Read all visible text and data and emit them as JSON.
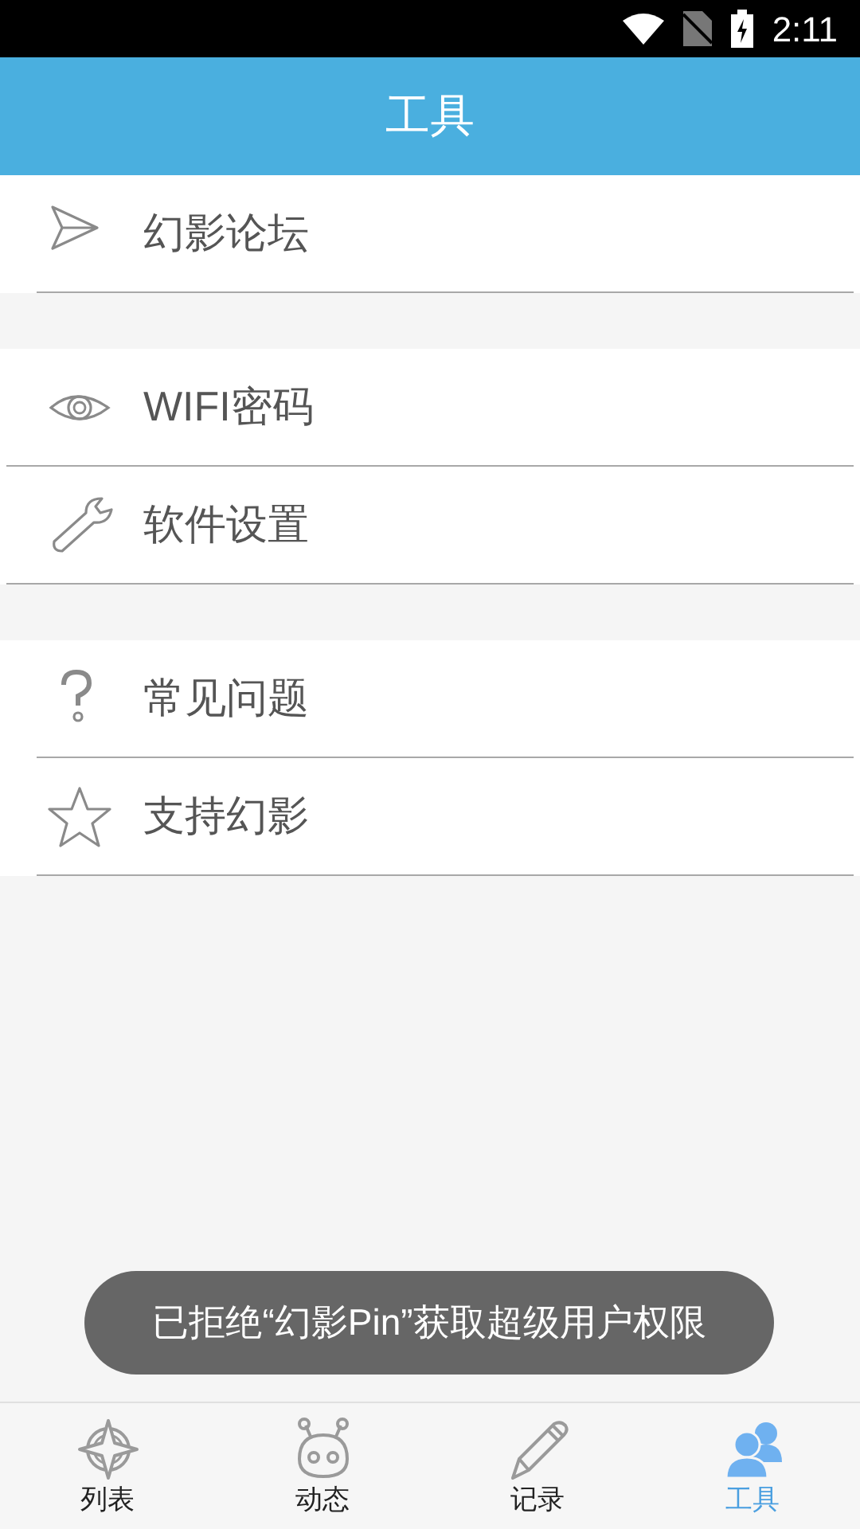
{
  "status_bar": {
    "time": "2:11"
  },
  "header": {
    "title": "工具"
  },
  "groups": [
    {
      "items": [
        {
          "kind": "send",
          "label": "幻影论坛"
        }
      ]
    },
    {
      "items": [
        {
          "kind": "eye",
          "label": "WIFI密码"
        },
        {
          "kind": "wrench",
          "label": "软件设置"
        }
      ]
    },
    {
      "items": [
        {
          "kind": "question",
          "label": "常见问题"
        },
        {
          "kind": "star",
          "label": "支持幻影"
        }
      ]
    }
  ],
  "toast": "已拒绝“幻影Pin”获取超级用户权限",
  "nav": [
    {
      "kind": "compass",
      "label": "列表",
      "selected": false
    },
    {
      "kind": "robot",
      "label": "动态",
      "selected": false
    },
    {
      "kind": "pencil",
      "label": "记录",
      "selected": false
    },
    {
      "kind": "people",
      "label": "工具",
      "selected": true
    }
  ]
}
